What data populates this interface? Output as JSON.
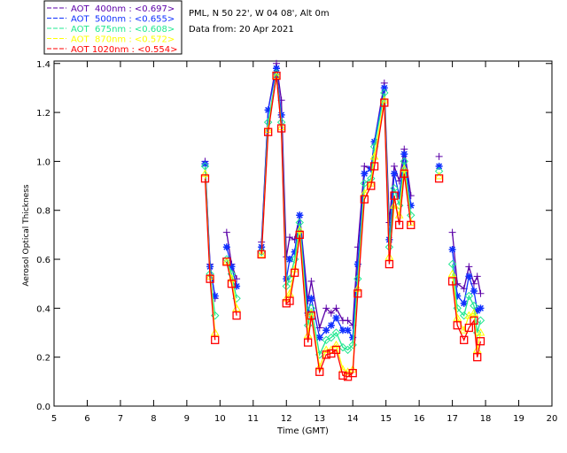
{
  "chart_data": {
    "type": "line",
    "title_lines": [
      "PML, N 50 22', W 04 08', Alt 0m",
      "Data from: 20 Apr 2021"
    ],
    "xlabel": "Time (GMT)",
    "ylabel": "Aerosol Optical Thickness",
    "xlim": [
      5,
      20
    ],
    "ylim": [
      0,
      1.41
    ],
    "xticks": [
      5,
      6,
      7,
      8,
      9,
      10,
      11,
      12,
      13,
      14,
      15,
      16,
      17,
      18,
      19,
      20
    ],
    "yticks": [
      "0.0",
      "0.2",
      "0.4",
      "0.6",
      "0.8",
      "1.0",
      "1.2",
      "1.4"
    ],
    "grid": false,
    "legend_position": "top-left (outside)",
    "x": [
      9.55,
      9.7,
      9.85,
      null,
      10.2,
      10.35,
      10.5,
      null,
      11.25,
      11.45,
      11.7,
      11.85,
      12.0,
      12.1,
      12.25,
      12.4,
      12.65,
      12.75,
      13.0,
      13.2,
      13.35,
      13.5,
      13.7,
      13.85,
      14.0,
      14.15,
      14.35,
      14.55,
      14.65,
      14.95,
      15.1,
      15.25,
      15.4,
      15.55,
      15.75,
      null,
      16.6,
      null,
      17.0,
      17.15,
      17.35,
      17.5,
      17.65,
      17.75,
      17.85
    ],
    "series": [
      {
        "name": "AOT  400nm : <0.697>",
        "color": "#5b00a8",
        "marker": "plus",
        "values": [
          1.0,
          0.58,
          0.44,
          null,
          0.71,
          0.58,
          0.52,
          null,
          0.67,
          1.21,
          1.4,
          1.25,
          0.61,
          0.69,
          0.68,
          0.78,
          0.43,
          0.51,
          0.32,
          0.4,
          0.38,
          0.4,
          0.35,
          0.35,
          0.33,
          0.65,
          0.98,
          0.97,
          1.08,
          1.32,
          0.75,
          0.98,
          0.92,
          1.05,
          0.86,
          null,
          1.02,
          null,
          0.71,
          0.5,
          0.48,
          0.57,
          0.5,
          0.53,
          0.46
        ]
      },
      {
        "name": "AOT  500nm : <0.655>",
        "color": "#1030ff",
        "marker": "asterisk",
        "values": [
          0.99,
          0.57,
          0.45,
          null,
          0.65,
          0.57,
          0.49,
          null,
          0.65,
          1.21,
          1.38,
          1.19,
          0.52,
          0.6,
          0.63,
          0.78,
          0.38,
          0.44,
          0.28,
          0.31,
          0.33,
          0.36,
          0.31,
          0.31,
          0.28,
          0.58,
          0.95,
          0.97,
          1.08,
          1.3,
          0.68,
          0.95,
          0.86,
          1.03,
          0.82,
          null,
          0.98,
          null,
          0.64,
          0.45,
          0.42,
          0.53,
          0.47,
          0.39,
          0.4
        ]
      },
      {
        "name": "AOT  675nm : <0.608>",
        "color": "#20e890",
        "marker": "diamond",
        "values": [
          0.98,
          0.54,
          0.37,
          null,
          0.6,
          0.54,
          0.44,
          null,
          0.63,
          1.16,
          1.36,
          1.16,
          0.49,
          0.52,
          0.6,
          0.75,
          0.33,
          0.4,
          0.21,
          0.27,
          0.28,
          0.3,
          0.24,
          0.23,
          0.25,
          0.52,
          0.91,
          0.93,
          1.06,
          1.28,
          0.65,
          0.89,
          0.82,
          1.0,
          0.78,
          null,
          0.96,
          null,
          0.58,
          0.4,
          0.37,
          0.45,
          0.41,
          0.3,
          0.35
        ]
      },
      {
        "name": "AOT  870nm : <0.572>",
        "color": "#ffff00",
        "marker": "triangle",
        "values": [
          0.95,
          0.53,
          0.3,
          null,
          0.59,
          0.52,
          0.4,
          null,
          0.62,
          1.13,
          1.35,
          1.14,
          0.44,
          0.46,
          0.56,
          0.72,
          0.29,
          0.38,
          0.16,
          0.23,
          0.23,
          0.25,
          0.15,
          0.14,
          0.15,
          0.48,
          0.87,
          0.91,
          1.02,
          1.25,
          0.61,
          0.82,
          0.78,
          0.97,
          0.75,
          null,
          0.94,
          null,
          0.54,
          0.36,
          0.31,
          0.37,
          0.38,
          0.23,
          0.3
        ]
      },
      {
        "name": "AOT 1020nm : <0.554>",
        "color": "#ff0000",
        "marker": "square",
        "values": [
          0.93,
          0.52,
          0.27,
          null,
          0.59,
          0.5,
          0.37,
          null,
          0.62,
          1.12,
          1.35,
          1.135,
          0.42,
          0.43,
          0.545,
          0.7,
          0.26,
          0.37,
          0.14,
          0.21,
          0.215,
          0.23,
          0.125,
          0.12,
          0.135,
          0.46,
          0.845,
          0.9,
          0.98,
          1.24,
          0.58,
          0.86,
          0.74,
          0.95,
          0.74,
          null,
          0.93,
          null,
          0.51,
          0.33,
          0.27,
          0.32,
          0.35,
          0.2,
          0.265
        ]
      }
    ]
  }
}
